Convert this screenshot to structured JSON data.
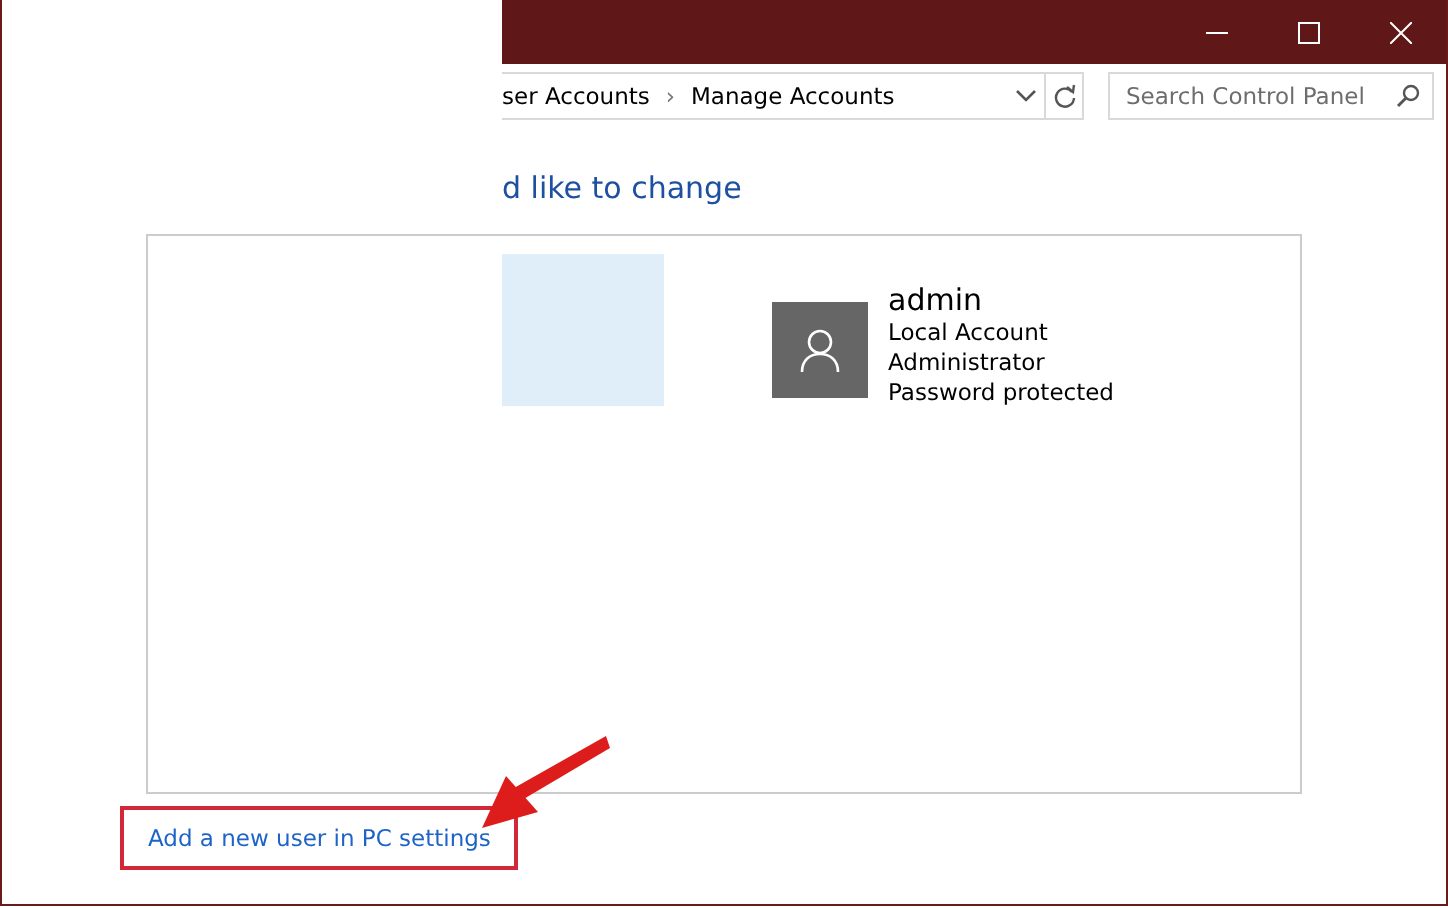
{
  "window": {
    "controls": [
      {
        "kind": "minimize"
      },
      {
        "kind": "maximize"
      },
      {
        "kind": "close"
      }
    ]
  },
  "address_bar": {
    "breadcrumbs": [
      "ser Accounts",
      "Manage Accounts"
    ],
    "separator": "›"
  },
  "search": {
    "placeholder": "Search Control Panel"
  },
  "heading": "d like to change",
  "accounts": [
    {
      "kind": "partial",
      "selected": true
    },
    {
      "kind": "user",
      "selected": false,
      "name": "admin",
      "details": [
        "Local Account",
        "Administrator",
        "Password protected"
      ]
    }
  ],
  "add_user_link": {
    "label": "Add a new user in PC settings",
    "highlighted": true
  }
}
